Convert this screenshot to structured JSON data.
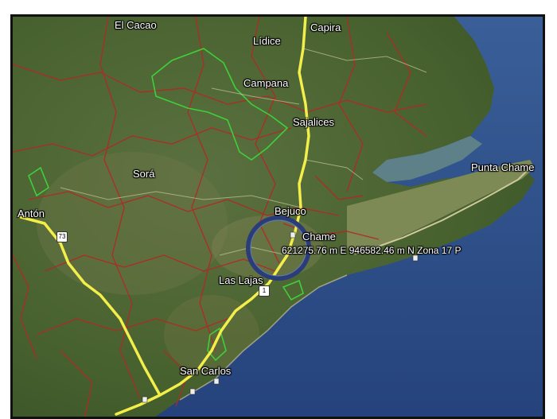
{
  "map": {
    "places": [
      {
        "id": "el-cacao",
        "label": "El Cacao"
      },
      {
        "id": "capira",
        "label": "Capira"
      },
      {
        "id": "lidice",
        "label": "Lídice"
      },
      {
        "id": "campana",
        "label": "Campana"
      },
      {
        "id": "sajalices",
        "label": "Sajalices"
      },
      {
        "id": "sora",
        "label": "Sorá"
      },
      {
        "id": "punta-chame",
        "label": "Punta Chame"
      },
      {
        "id": "anton",
        "label": "Antón"
      },
      {
        "id": "bejuco",
        "label": "Bejuco"
      },
      {
        "id": "chame",
        "label": "Chame"
      },
      {
        "id": "las-lajas",
        "label": "Las Lajas"
      },
      {
        "id": "san-carlos",
        "label": "San Carlos"
      }
    ],
    "coordinate_label": "621275.76 m E 946582.46 m N Zona 17 P",
    "route_shields": [
      "73",
      "1"
    ],
    "colors": {
      "highway": "#f3ee4a",
      "boundary": "#b02a25",
      "protected_area": "#3fcf3a",
      "marker_ring": "#2a3d78",
      "sea": "#2d4c86",
      "land": "#4a6433"
    }
  }
}
